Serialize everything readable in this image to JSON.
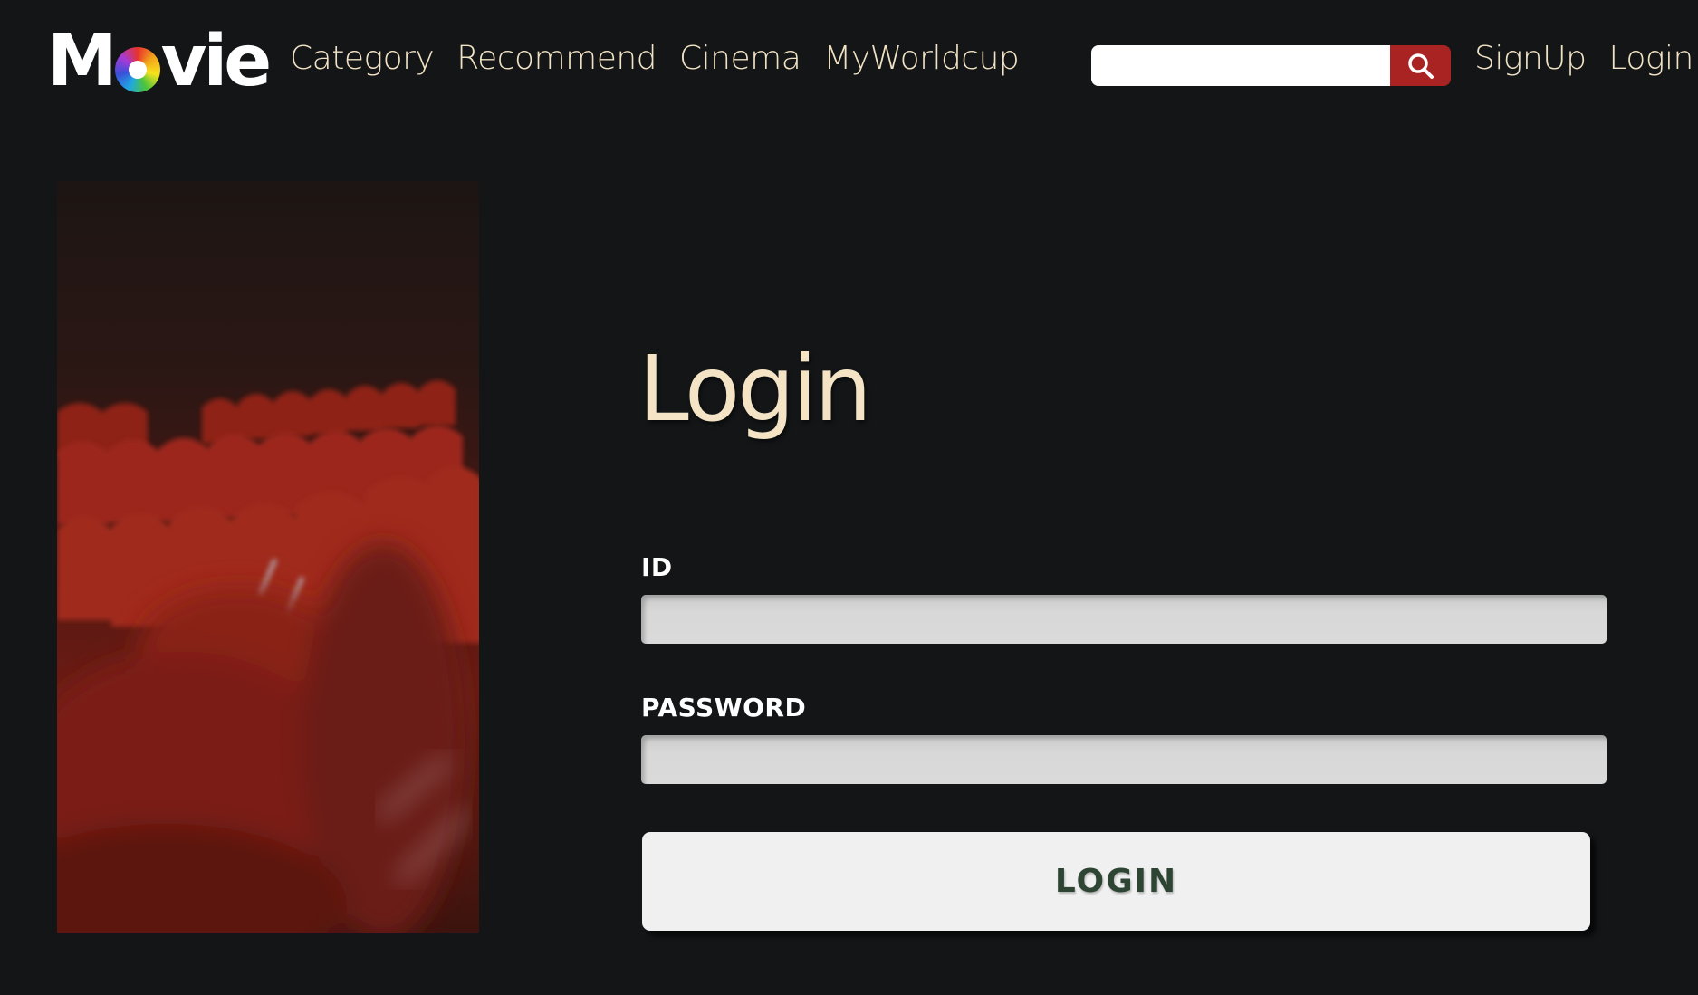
{
  "header": {
    "logo_text": "Movie",
    "nav": [
      {
        "label": "Category"
      },
      {
        "label": "Recommend"
      },
      {
        "label": "Cinema"
      },
      {
        "label": "MyWorldcup"
      }
    ],
    "search": {
      "value": "",
      "placeholder": "",
      "icon": "search-icon"
    },
    "auth": [
      {
        "label": "SignUp"
      },
      {
        "label": "Login"
      }
    ]
  },
  "hero_image": {
    "subject": "cinema-seats-photo"
  },
  "login_form": {
    "title": "Login",
    "id_label": "ID",
    "id_value": "",
    "password_label": "PASSWORD",
    "password_value": "",
    "submit_label": "LOGIN"
  },
  "colors": {
    "background": "#131517",
    "nav_text": "#f1e2c4",
    "search_button": "#a92323",
    "input_bg": "#d8d8d8",
    "button_bg": "#f0f0f0",
    "button_text": "#2f4534"
  }
}
